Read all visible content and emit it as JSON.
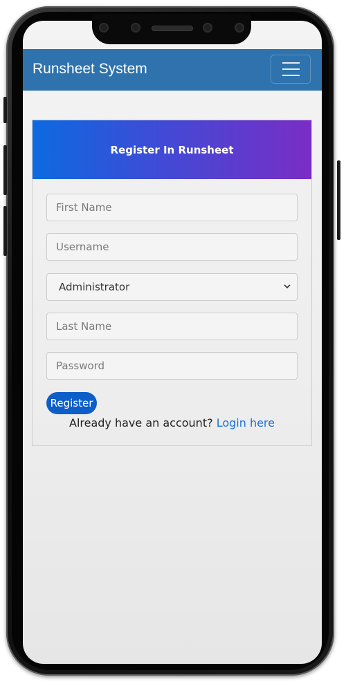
{
  "navbar": {
    "brand": "Runsheet System",
    "toggle_icon": "hamburger-menu-icon"
  },
  "form": {
    "heading": "Register In Runsheet",
    "first_name_placeholder": "First Name",
    "username_placeholder": "Username",
    "role_selected": "Administrator",
    "last_name_placeholder": "Last Name",
    "password_placeholder": "Password",
    "register_label": "Register",
    "login_prompt": "Already have an account?",
    "login_link": "Login here"
  },
  "colors": {
    "navbar": "#2e72ae",
    "header_gradient_start": "#0c6ae0",
    "header_gradient_end": "#7a2dc5",
    "button": "#0d5ec8",
    "link": "#1a73d8"
  }
}
